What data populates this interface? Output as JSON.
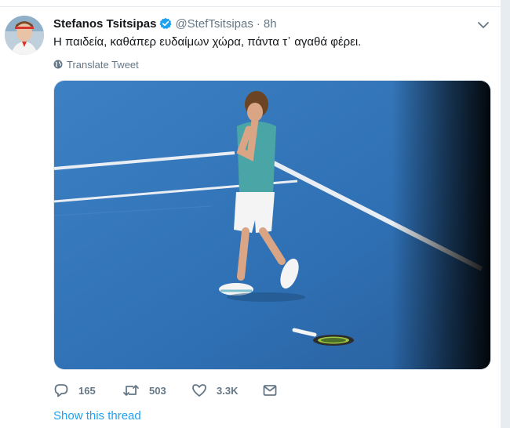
{
  "tweet": {
    "display_name": "Stefanos Tsitsipas",
    "handle": "@StefTsitsipas",
    "separator": "·",
    "time": "8h",
    "verified": true,
    "text": "Η παιδεία, καθάπερ ευδαίμων χώρα, πάντα τ᾽ αγαθά φέρει.",
    "translate_label": "Translate Tweet",
    "media_icon": "tennis-court-photo"
  },
  "actions": {
    "reply_count": "165",
    "retweet_count": "503",
    "like_count": "3.3K"
  },
  "thread_link": "Show this thread",
  "colors": {
    "accent": "#1da1f2",
    "secondary_text": "#657786",
    "court_blue": "#2b6eb2"
  }
}
